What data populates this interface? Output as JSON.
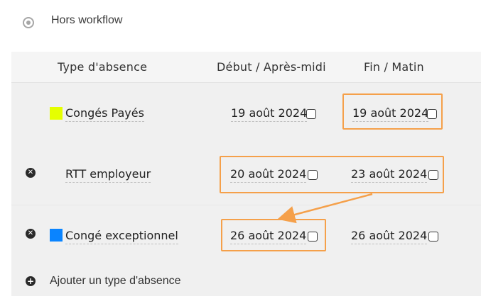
{
  "workflow_option": {
    "label": "Hors workflow",
    "icon": "radio-icon"
  },
  "table": {
    "headers": {
      "type": "Type d'absence",
      "start": "Début / Après-midi",
      "end": "Fin / Matin"
    },
    "rows": [
      {
        "type": "Congés Payés",
        "swatch_color": "#e5ff00",
        "start": "19 août 2024",
        "end": "19 août 2024",
        "removable": false
      },
      {
        "type": "RTT employeur",
        "swatch_color": "",
        "start": "20 août 2024",
        "end": "23 août 2024",
        "removable": true
      },
      {
        "type": "Congé exceptionnel",
        "swatch_color": "#0a84ff",
        "start": "26 août 2024",
        "end": "26 août 2024",
        "removable": true
      }
    ],
    "add_label": "Ajouter un type d'absence"
  },
  "colors": {
    "highlight": "#f5a04a",
    "background": "#f0f0f0"
  },
  "icons": {
    "remove": "remove-circle-icon",
    "add": "add-circle-icon",
    "checkbox": "checkbox-icon"
  }
}
